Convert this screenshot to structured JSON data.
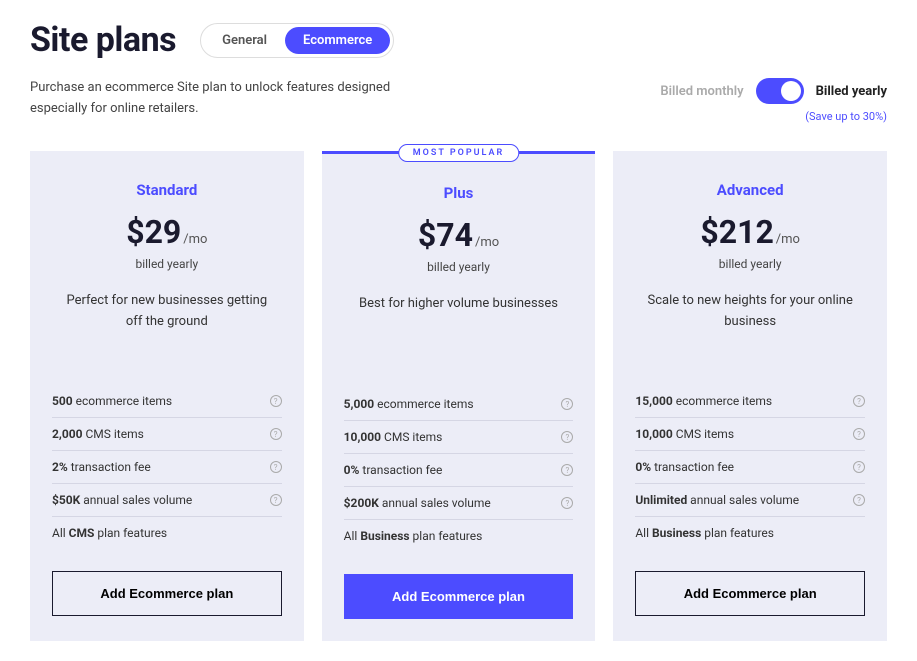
{
  "header": {
    "title": "Site plans",
    "tabs": [
      "General",
      "Ecommerce"
    ],
    "active_tab": 1,
    "subtitle": "Purchase an ecommerce Site plan to unlock features designed especially for online retailers."
  },
  "billing": {
    "monthly_label": "Billed monthly",
    "yearly_label": "Billed yearly",
    "save_note": "(Save up to 30%)",
    "selected": "yearly"
  },
  "plans": [
    {
      "name": "Standard",
      "price": "$29",
      "per": "/mo",
      "billed": "billed yearly",
      "desc": "Perfect for new businesses getting off the ground",
      "popular": false,
      "cta_label": "Add Ecommerce plan",
      "cta_primary": false,
      "features": [
        {
          "bold": "500",
          "rest": " ecommerce items",
          "info": true
        },
        {
          "bold": "2,000",
          "rest": " CMS items",
          "info": true
        },
        {
          "bold": "2%",
          "rest": " transaction fee",
          "info": true
        },
        {
          "bold": "$50K",
          "rest": " annual sales volume",
          "info": true
        },
        {
          "prefix": "All ",
          "bold": "CMS",
          "rest": " plan features",
          "info": false
        }
      ]
    },
    {
      "name": "Plus",
      "price": "$74",
      "per": "/mo",
      "billed": "billed yearly",
      "desc": "Best for higher volume businesses",
      "popular": true,
      "badge": "MOST POPULAR",
      "cta_label": "Add Ecommerce plan",
      "cta_primary": true,
      "features": [
        {
          "bold": "5,000",
          "rest": " ecommerce items",
          "info": true
        },
        {
          "bold": "10,000",
          "rest": " CMS items",
          "info": true
        },
        {
          "bold": "0%",
          "rest": " transaction fee",
          "info": true
        },
        {
          "bold": "$200K",
          "rest": " annual sales volume",
          "info": true
        },
        {
          "prefix": "All ",
          "bold": "Business",
          "rest": " plan features",
          "info": false
        }
      ]
    },
    {
      "name": "Advanced",
      "price": "$212",
      "per": "/mo",
      "billed": "billed yearly",
      "desc": "Scale to new heights for your online business",
      "popular": false,
      "cta_label": "Add Ecommerce plan",
      "cta_primary": false,
      "features": [
        {
          "bold": "15,000",
          "rest": " ecommerce items",
          "info": true
        },
        {
          "bold": "10,000",
          "rest": " CMS items",
          "info": true
        },
        {
          "bold": "0%",
          "rest": " transaction fee",
          "info": true
        },
        {
          "bold": "Unlimited",
          "rest": " annual sales volume",
          "info": true
        },
        {
          "prefix": "All ",
          "bold": "Business",
          "rest": " plan features",
          "info": false
        }
      ]
    }
  ]
}
